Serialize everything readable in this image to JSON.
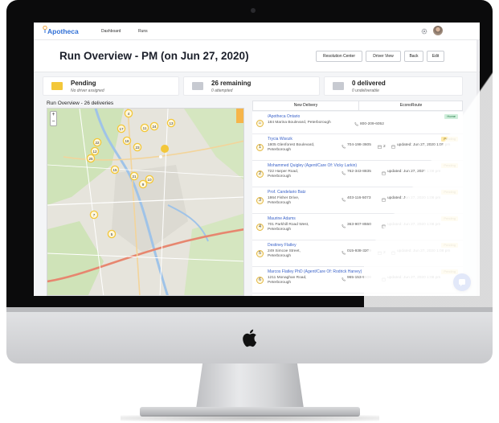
{
  "nav": {
    "logo": "Apotheca",
    "links": [
      "Dashboard",
      "Runs"
    ]
  },
  "header": {
    "title": "Run Overview - PM (on Jun 27, 2020)",
    "buttons": [
      "Resolution Center",
      "Driver View",
      "Back",
      "Edit"
    ]
  },
  "stats": [
    {
      "main": "Pending",
      "sub": "No driver assigned",
      "color": "#f3c73a"
    },
    {
      "main": "26 remaining",
      "sub": "0 attempted",
      "color": "#c7cad1"
    },
    {
      "main": "0 delivered",
      "sub": "0 undeliverable",
      "color": "#c7cad1"
    }
  ],
  "map": {
    "label": "Run Overview - 26 deliveries",
    "zoom_in": "+",
    "zoom_out": "−",
    "markers": [
      "26",
      "16",
      "8",
      "4",
      "17",
      "11",
      "24",
      "13",
      "22",
      "12",
      "18",
      "23",
      "25",
      "15",
      "21",
      "10",
      "9",
      "7",
      "5"
    ]
  },
  "tabs": [
    "New Delivery",
    "EconoRoute"
  ],
  "deliveries": [
    {
      "num": "",
      "name": "/Apotheca Ontario",
      "address": "184 Marina Boulevard, Peterborough",
      "phone": "800-209-6052",
      "packages": "",
      "updated": "",
      "status": "Home",
      "depot": true
    },
    {
      "num": "1",
      "name": "Trycia Wisozk",
      "address": "1805 Glenforest Boulevard, Peterborough",
      "phone": "704-198-3605",
      "packages": "2",
      "updated": "updated: Jun 27, 2020 1:08 pm",
      "status": "Pending"
    },
    {
      "num": "2",
      "name": "Mohammed Quigley (Agent/Care Of: Vicky Larkin)",
      "address": "722 Harper Road, Peterborough",
      "phone": "762-343-8835",
      "packages": "",
      "updated": "updated: Jun 27, 2020 1:08 pm",
      "status": "Pending"
    },
    {
      "num": "3",
      "name": "Prof. Candelario Batz",
      "address": "1864 Fisher Drive, Peterborough",
      "phone": "403-116-5073",
      "packages": "",
      "updated": "updated: Jun 27, 2020 1:08 pm",
      "status": "Pending"
    },
    {
      "num": "4",
      "name": "Maurine Adams",
      "address": "701 Parkhill Road West, Peterborough",
      "phone": "363-907-8550",
      "packages": "",
      "updated": "updated: Jun 27, 2020 1:08 pm",
      "status": "Pending"
    },
    {
      "num": "5",
      "name": "Destiney Flatley",
      "address": "249 Simcoe Street, Peterborough",
      "phone": "015-938-3209",
      "packages": "2",
      "updated": "updated: Jun 27, 2020 1:08 pm",
      "status": "Pending"
    },
    {
      "num": "6",
      "name": "Marcos Flatley PhD (Agent/Care Of: Rodrick Harvey)",
      "address": "1211 Monaghan Road, Peterborough",
      "phone": "965-153-9506",
      "packages": "",
      "updated": "updated: Jun 27, 2020 1:08 pm",
      "status": "Pending"
    }
  ],
  "colors": {
    "accent": "#3b63c9",
    "pending_badge": "#fde9a9",
    "home_badge": "#cfeedb",
    "marker": "#f3c73a"
  }
}
